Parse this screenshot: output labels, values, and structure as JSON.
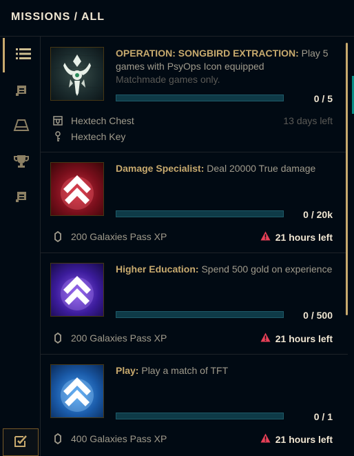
{
  "header": {
    "title": "MISSIONS / ALL"
  },
  "sidebar": {
    "items": [
      {
        "icon": "list-icon",
        "active": true
      },
      {
        "icon": "scroll-icon"
      },
      {
        "icon": "tent-icon"
      },
      {
        "icon": "trophy-icon"
      },
      {
        "icon": "scroll-icon"
      }
    ],
    "bottom_icon": "checkbox-icon"
  },
  "missions": [
    {
      "title": "OPERATION: SONGBIRD EXTRACTION:",
      "description": "Play 5 games with PsyOps Icon equipped",
      "subtext": "Matchmade games only.",
      "progress": "0 / 5",
      "progress_fraction": 0,
      "rewards": [
        {
          "icon": "chest-icon",
          "label": "Hextech Chest"
        },
        {
          "icon": "key-icon",
          "label": "Hextech Key"
        }
      ],
      "time_left": "13 days left"
    },
    {
      "title": "Damage Specialist:",
      "description": "Deal 20000 True damage",
      "progress": "0 / 20k",
      "progress_fraction": 0,
      "rewards": [
        {
          "icon": "pass-xp-icon",
          "label": "200 Galaxies Pass XP"
        }
      ],
      "time_left": "21 hours left"
    },
    {
      "title": "Higher Education:",
      "description": "Spend 500 gold on experience",
      "progress": "0 / 500",
      "progress_fraction": 0,
      "rewards": [
        {
          "icon": "pass-xp-icon",
          "label": "200 Galaxies Pass XP"
        }
      ],
      "time_left": "21 hours left"
    },
    {
      "title": "Play:",
      "description": "Play a match of TFT",
      "progress": "0 / 1",
      "progress_fraction": 0,
      "rewards": [
        {
          "icon": "pass-xp-icon",
          "label": "400 Galaxies Pass XP"
        }
      ],
      "time_left": "21 hours left"
    }
  ],
  "colors": {
    "gold": "#c8aa6e",
    "text": "#a09b8c",
    "bright": "#f0e6d2",
    "warning": "#e84057",
    "bar_bg": "#0e3a47"
  }
}
